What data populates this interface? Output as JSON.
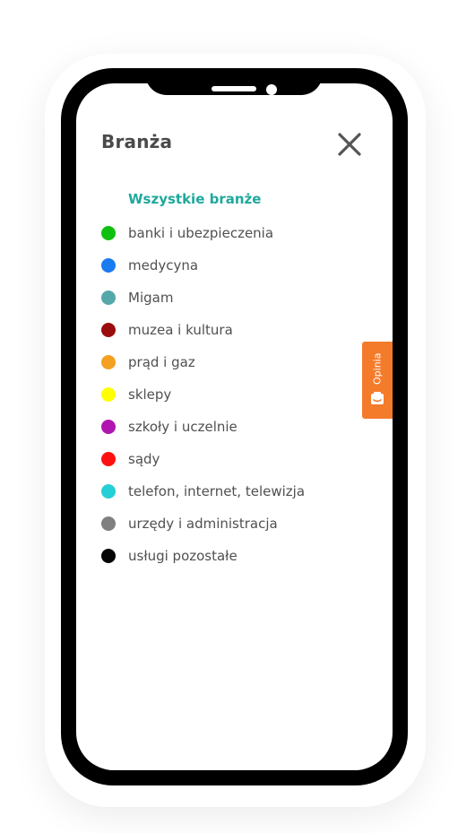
{
  "panel": {
    "title": "Branża",
    "all_label": "Wszystkie branże",
    "all_color": "#1fa89c"
  },
  "industries": [
    {
      "label": "banki i ubezpieczenia",
      "color": "#10c010"
    },
    {
      "label": "medycyna",
      "color": "#1a7af0"
    },
    {
      "label": "Migam",
      "color": "#55a8aa"
    },
    {
      "label": "muzea i kultura",
      "color": "#9b0d0d"
    },
    {
      "label": "prąd i gaz",
      "color": "#f4a020"
    },
    {
      "label": "sklepy",
      "color": "#ffff00"
    },
    {
      "label": "szkoły i uczelnie",
      "color": "#b015b0"
    },
    {
      "label": "sądy",
      "color": "#ff1010"
    },
    {
      "label": "telefon, internet, telewizja",
      "color": "#25cfd8"
    },
    {
      "label": "urzędy i administracja",
      "color": "#808080"
    },
    {
      "label": "usługi pozostałe",
      "color": "#050505"
    }
  ],
  "feedback": {
    "label": "Opinia",
    "icon": "chat-icon",
    "color": "#f47b2a"
  },
  "icons": {
    "close": "close-icon"
  }
}
